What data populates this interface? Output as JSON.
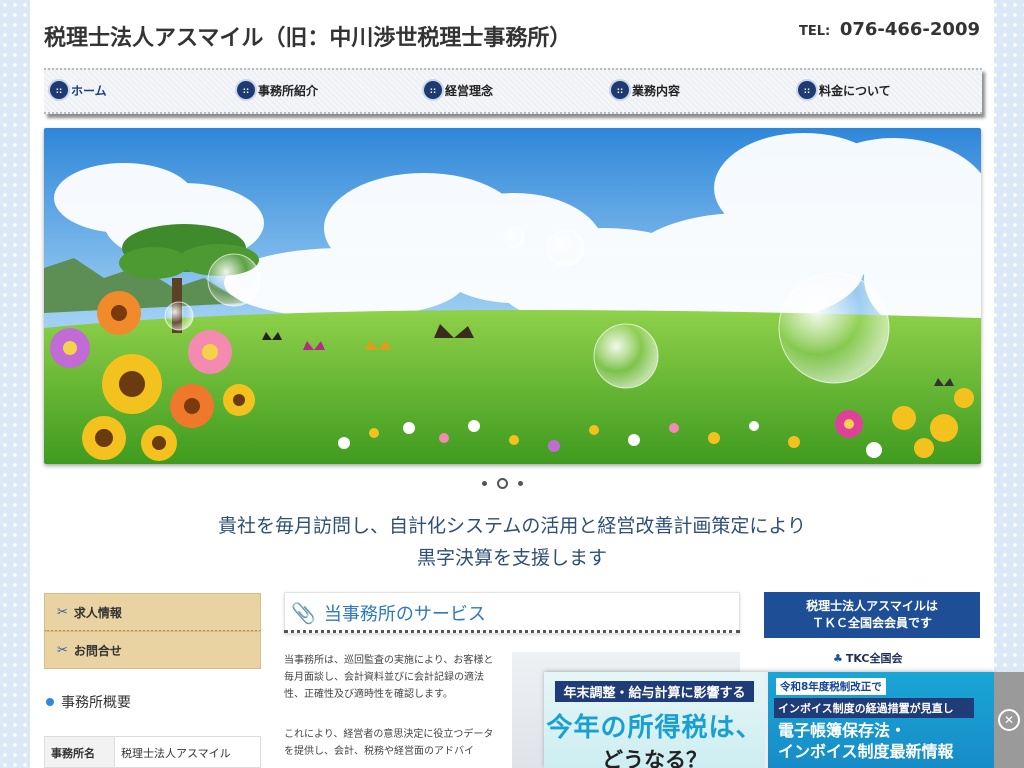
{
  "header": {
    "title": "税理士法人アスマイル（旧：中川渉世税理士事務所）",
    "tel_label": "TEL:",
    "tel_number": "076-466-2009"
  },
  "nav": {
    "items": [
      {
        "label": "ホーム",
        "active": true
      },
      {
        "label": "事務所紹介"
      },
      {
        "label": "経営理念"
      },
      {
        "label": "業務内容"
      },
      {
        "label": "料金について"
      }
    ]
  },
  "slider": {
    "slide_count": 3,
    "active_index": 1
  },
  "catchphrase": {
    "line1": "貴社を毎月訪問し、自計化システムの活用と経営改善計画策定により",
    "line2": "黒字決算を支援します"
  },
  "sidebar": {
    "links": [
      {
        "label": "求人情報",
        "icon": "scissors-icon"
      },
      {
        "label": "お問合せ",
        "icon": "scissors-icon"
      }
    ],
    "overview_heading": "事務所概要",
    "overview_rows": [
      {
        "key": "事務所名",
        "value": "税理士法人アスマイル"
      }
    ]
  },
  "service": {
    "heading": "当事務所のサービス",
    "para1": "当事務所は、巡回監査の実施により、お客様と毎月面談し、会計資料並びに会計記録の適法性、正確性及び適時性を確認します。",
    "para2": "これにより、経営者の意思決定に役立つデータを提供し、会計、税務や経営面のアドバイ"
  },
  "tkc": {
    "box_line1": "税理士法人アスマイルは",
    "box_line2": "ＴＫＣ全国会会員です",
    "logo_text": "TKC全国会"
  },
  "ad": {
    "left_line1": "年末調整・給与計算に影響する",
    "left_line2": "今年の所得税は、",
    "left_line3": "どうなる？",
    "right_line1": "令和8年度税制改正で",
    "right_line2": "インボイス制度の経過措置が見直し",
    "right_line3": "電子帳簿保存法・",
    "right_line4": "インボイス制度最新情報",
    "close_icon": "close-icon"
  }
}
